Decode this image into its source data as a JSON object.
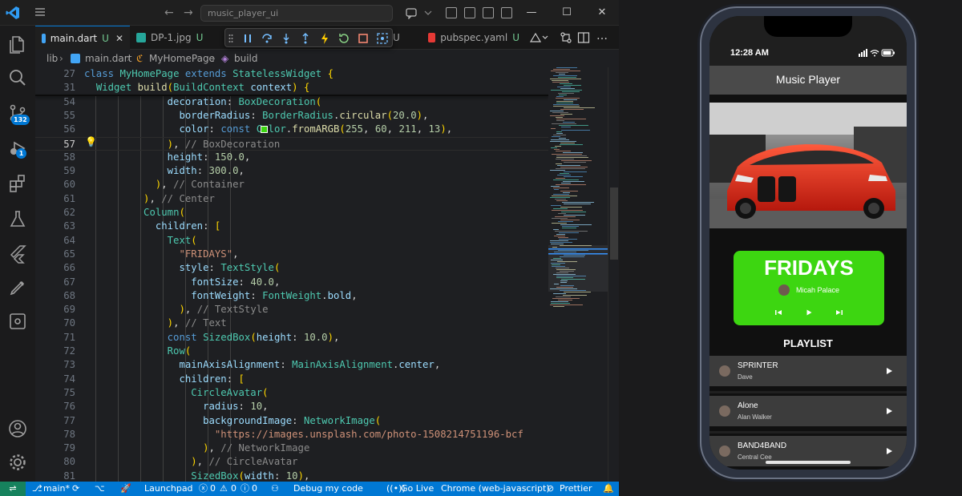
{
  "titlebar": {
    "search_text": "music_player_ui"
  },
  "tabs": [
    {
      "label": "main.dart",
      "status": "U"
    },
    {
      "label": "DP-1.jpg",
      "status": "U"
    },
    {
      "label": "U",
      "status": ""
    },
    {
      "label": "pubspec.yaml",
      "status": "U"
    }
  ],
  "activity": {
    "scm_badge": "132",
    "debug_badge": "1"
  },
  "breadcrumb": {
    "folder": "lib",
    "file": "main.dart",
    "class": "MyHomePage",
    "method": "build"
  },
  "editor": {
    "lines": [
      {
        "n": "27",
        "text": "class MyHomePage extends StatelessWidget {"
      },
      {
        "n": "31",
        "text": "  Widget build(BuildContext context) {"
      },
      {
        "n": "54",
        "text": "              decoration: BoxDecoration("
      },
      {
        "n": "55",
        "text": "                borderRadius: BorderRadius.circular(20.0),"
      },
      {
        "n": "56",
        "text": "                color: const Color.fromARGB(255, 60, 211, 13),"
      },
      {
        "n": "57",
        "text": "              ), // BoxDecoration"
      },
      {
        "n": "58",
        "text": "              height: 150.0,"
      },
      {
        "n": "59",
        "text": "              width: 300.0,"
      },
      {
        "n": "60",
        "text": "            ), // Container"
      },
      {
        "n": "61",
        "text": "          ), // Center"
      },
      {
        "n": "62",
        "text": "          Column("
      },
      {
        "n": "63",
        "text": "            children: ["
      },
      {
        "n": "64",
        "text": "              Text("
      },
      {
        "n": "65",
        "text": "                \"FRIDAYS\","
      },
      {
        "n": "66",
        "text": "                style: TextStyle("
      },
      {
        "n": "67",
        "text": "                  fontSize: 40.0,"
      },
      {
        "n": "68",
        "text": "                  fontWeight: FontWeight.bold,"
      },
      {
        "n": "69",
        "text": "                ), // TextStyle"
      },
      {
        "n": "70",
        "text": "              ), // Text"
      },
      {
        "n": "71",
        "text": "              const SizedBox(height: 10.0),"
      },
      {
        "n": "72",
        "text": "              Row("
      },
      {
        "n": "73",
        "text": "                mainAxisAlignment: MainAxisAlignment.center,"
      },
      {
        "n": "74",
        "text": "                children: ["
      },
      {
        "n": "75",
        "text": "                  CircleAvatar("
      },
      {
        "n": "76",
        "text": "                    radius: 10,"
      },
      {
        "n": "77",
        "text": "                    backgroundImage: NetworkImage("
      },
      {
        "n": "78",
        "text": "                      \"https://images.unsplash.com/photo-1508214751196-bcf"
      },
      {
        "n": "79",
        "text": "                    ), // NetworkImage"
      },
      {
        "n": "80",
        "text": "                  ), // CircleAvatar"
      },
      {
        "n": "81",
        "text": "                  SizedBox(width: 10),"
      }
    ],
    "active_line": "57"
  },
  "statusbar": {
    "branch": "main*",
    "launchpad": "Launchpad",
    "problems": "0",
    "warnings": "0",
    "info": "0",
    "debug": "Debug my code",
    "golive": "Go Live",
    "device": "Chrome (web-javascript)",
    "prettier": "Prettier"
  },
  "phone": {
    "time": "12:28 AM",
    "app_title": "Music Player",
    "card": {
      "title": "FRIDAYS",
      "artist": "Micah Palace",
      "color": "#3dd611"
    },
    "playlist_title": "PLAYLIST",
    "songs": [
      {
        "title": "SPRINTER",
        "artist": "Dave"
      },
      {
        "title": "Alone",
        "artist": "Alan Walker"
      },
      {
        "title": "BAND4BAND",
        "artist": "Central Cee"
      }
    ]
  },
  "colors": {
    "accent": "#0078d4",
    "card_green": "#3dd611",
    "appbar": "#4a4a4a"
  }
}
